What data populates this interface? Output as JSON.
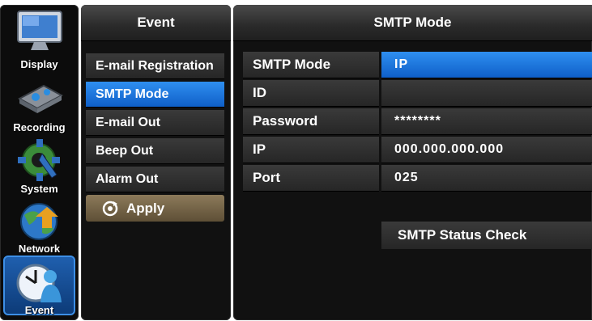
{
  "sidebar": {
    "categories": [
      {
        "label": "Display",
        "icon": "display-icon"
      },
      {
        "label": "Recording",
        "icon": "recording-icon"
      },
      {
        "label": "System",
        "icon": "system-gear-icon"
      },
      {
        "label": "Network",
        "icon": "network-globe-icon"
      },
      {
        "label": "Event",
        "icon": "event-clock-icon",
        "selected": true
      }
    ]
  },
  "menu": {
    "title": "Event",
    "items": [
      {
        "label": "E-mail Registration"
      },
      {
        "label": "SMTP Mode",
        "selected": true
      },
      {
        "label": "E-mail Out"
      },
      {
        "label": "Beep Out"
      },
      {
        "label": "Alarm Out"
      }
    ],
    "apply_label": "Apply"
  },
  "main": {
    "title": "SMTP Mode",
    "fields": [
      {
        "label": "SMTP Mode",
        "value": "IP",
        "selected": true
      },
      {
        "label": "ID",
        "value": ""
      },
      {
        "label": "Password",
        "value": "********"
      },
      {
        "label": "IP",
        "value": "000.000.000.000"
      },
      {
        "label": "Port",
        "value": "025"
      }
    ],
    "status_check_label": "SMTP Status Check"
  },
  "colors": {
    "selection_blue": "#1f78e0",
    "apply_brown": "#7a6a4a",
    "panel_dark": "#111111"
  }
}
